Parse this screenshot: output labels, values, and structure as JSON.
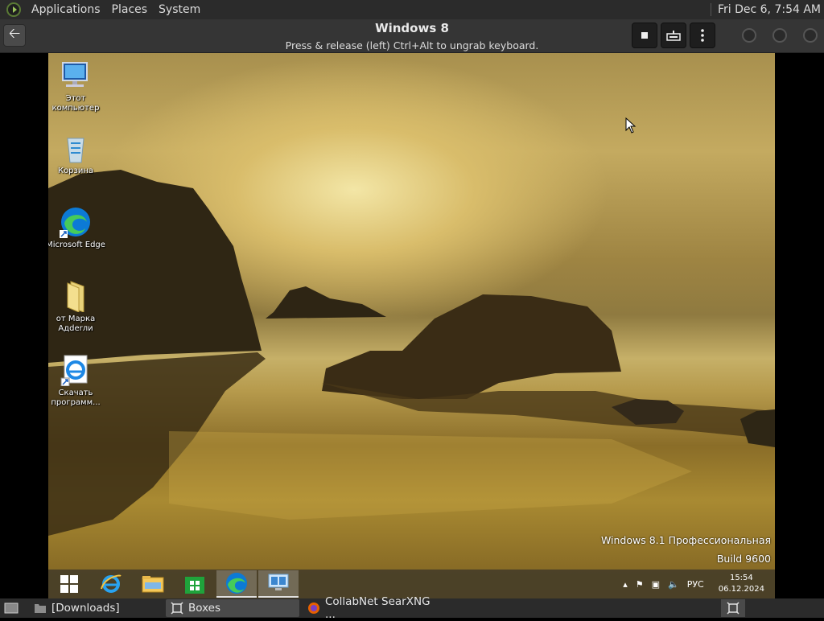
{
  "top_panel": {
    "menus": [
      "Applications",
      "Places",
      "System"
    ],
    "clock": "Fri Dec  6,  7:54 AM"
  },
  "boxes_header": {
    "title": "Windows 8",
    "hint": "Press & release (left) Ctrl+Alt to ungrab keyboard.",
    "buttons": [
      "stop",
      "keyboard",
      "menu"
    ]
  },
  "vm": {
    "desktop_icons": [
      {
        "label": "Этот компьютер",
        "icon": "computer-icon"
      },
      {
        "label": "Корзина",
        "icon": "recycle-bin-icon"
      },
      {
        "label": "Microsoft Edge",
        "icon": "edge-icon"
      },
      {
        "label": "от Марка Адderли",
        "icon": "folder-icon"
      },
      {
        "label": "Скачать программ...",
        "icon": "ie-shortcut-icon"
      }
    ],
    "watermark": {
      "line1": "Windows 8.1 Профессиональная",
      "line2": "Build 9600"
    },
    "taskbar": {
      "items": [
        "start",
        "internet-explorer",
        "file-explorer",
        "store",
        "edge",
        "remote-desktop"
      ],
      "tray": {
        "lang": "РУС",
        "time": "15:54",
        "date": "06.12.2024"
      }
    }
  },
  "bottom_panel": {
    "tasks": [
      {
        "label": "[Downloads]",
        "icon": "folder-icon"
      },
      {
        "label": "Boxes",
        "icon": "boxes-icon"
      },
      {
        "label": "CollabNet SearXNG ...",
        "icon": "firefox-icon"
      }
    ]
  },
  "colors": {
    "panel": "#2b2b2b",
    "header": "#353535",
    "accent": "#0078d7"
  }
}
